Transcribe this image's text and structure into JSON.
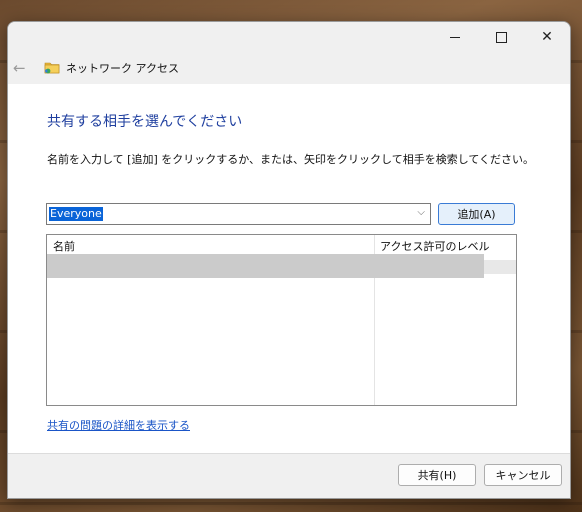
{
  "window": {
    "caption_min": "—",
    "caption_max": "☐",
    "caption_close": "✕"
  },
  "nav": {
    "back_icon": "left-arrow-icon",
    "app_icon": "network-access-icon",
    "title": "ネットワーク アクセス"
  },
  "main": {
    "heading": "共有する相手を選んでください",
    "instructions": "名前を入力して [追加] をクリックするか、または、矢印をクリックして相手を検索してください。",
    "combo": {
      "value": "Everyone",
      "arrow_icon": "chevron-down-icon"
    },
    "add_button": "追加(A)",
    "list": {
      "columns": [
        "名前",
        "アクセス許可のレベル"
      ],
      "rows": []
    },
    "problem_link": "共有の問題の詳細を表示する"
  },
  "footer": {
    "share_button": "共有(H)",
    "cancel_button": "キャンセル"
  },
  "colors": {
    "heading": "#1f3f9f",
    "link": "#1a55c7",
    "selection": "#0a64d8",
    "add_button_border": "#3a7bd5"
  }
}
